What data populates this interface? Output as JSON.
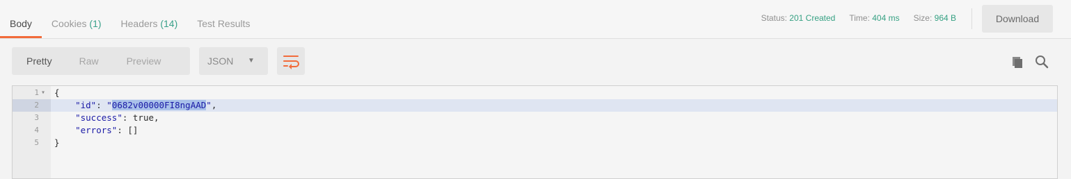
{
  "tabs": [
    {
      "label": "Body",
      "count": ""
    },
    {
      "label": "Cookies",
      "count": "(1)"
    },
    {
      "label": "Headers",
      "count": "(14)"
    },
    {
      "label": "Test Results",
      "count": ""
    }
  ],
  "status": {
    "status_label": "Status:",
    "status_value": "201 Created",
    "time_label": "Time:",
    "time_value": "404 ms",
    "size_label": "Size:",
    "size_value": "964 B"
  },
  "download_label": "Download",
  "view_modes": [
    "Pretty",
    "Raw",
    "Preview"
  ],
  "selected_view_mode": "Pretty",
  "format": "JSON",
  "icons": {
    "wrap": "wrap-lines-icon",
    "copy": "copy-icon",
    "search": "search-icon",
    "caret": "caret-down-icon"
  },
  "colors": {
    "accent": "#f26b3a",
    "status_green": "#36a183",
    "json_blue": "#1a1aa6",
    "selection": "#a9c1ea"
  },
  "editor": {
    "lines": [
      {
        "n": "1",
        "fold": "▾",
        "text": "{"
      },
      {
        "n": "2",
        "fold": "",
        "key": "\"id\"",
        "sep": ": ",
        "value": "\"0682v00000FI8ngAAD\"",
        "tail": ","
      },
      {
        "n": "3",
        "fold": "",
        "key": "\"success\"",
        "sep": ": ",
        "value": "true",
        "tail": ","
      },
      {
        "n": "4",
        "fold": "",
        "key": "\"errors\"",
        "sep": ": ",
        "value": "[]",
        "tail": ""
      },
      {
        "n": "5",
        "fold": "",
        "text": "}"
      }
    ]
  }
}
